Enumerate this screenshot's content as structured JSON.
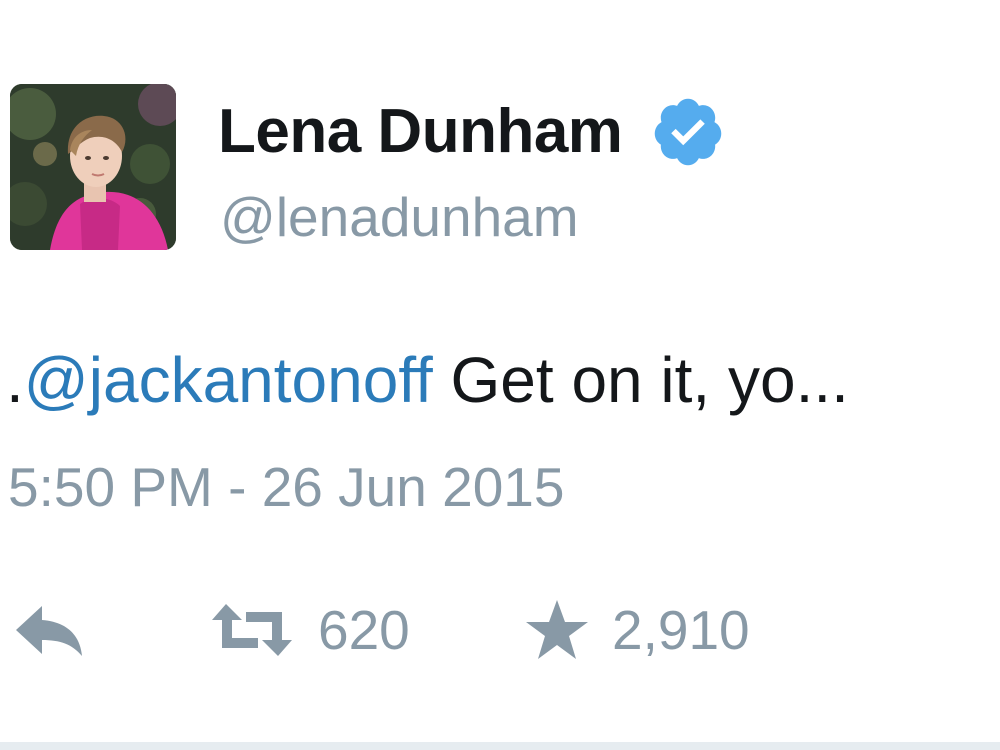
{
  "user": {
    "display_name": "Lena Dunham",
    "handle": "@lenadunham",
    "verified": true
  },
  "tweet": {
    "prefix": ".",
    "mention": "@jackantonoff",
    "text": " Get on it, yo...",
    "timestamp": "5:50 PM - 26 Jun 2015"
  },
  "actions": {
    "reply": {
      "icon": "reply-icon"
    },
    "retweet": {
      "icon": "retweet-icon",
      "count": "620"
    },
    "favorite": {
      "icon": "star-icon",
      "count": "2,910"
    }
  },
  "colors": {
    "text": "#14171a",
    "muted": "#8899a6",
    "link": "#2b7bb9",
    "verified": "#55acee"
  }
}
